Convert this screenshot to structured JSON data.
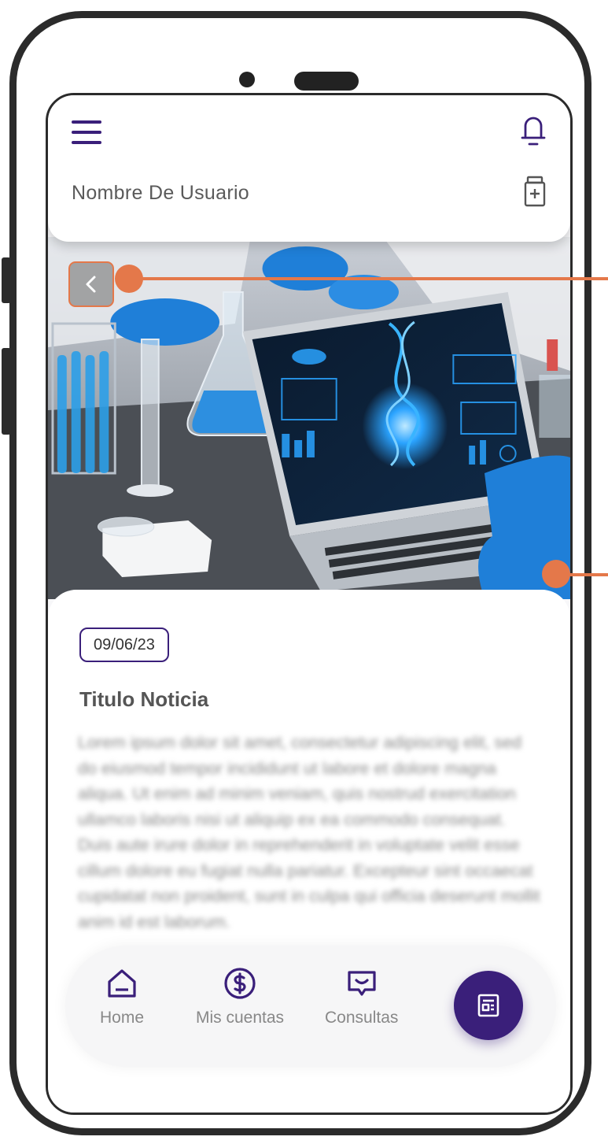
{
  "header": {
    "username": "Nombre De Usuario",
    "icons": {
      "menu": "hamburger-menu-icon",
      "notifications": "bell-icon",
      "medical": "medicine-bottle-icon"
    }
  },
  "hero": {
    "image_subject": "lab-laptop-dna",
    "back_icon": "chevron-left-icon"
  },
  "article": {
    "date": "09/06/23",
    "title": "Titulo Noticia",
    "body": "Lorem ipsum dolor sit amet, consectetur adipiscing elit, sed do eiusmod tempor incididunt ut labore et dolore magna aliqua. Ut enim ad minim veniam, quis nostrud exercitation ullamco laboris nisi ut aliquip ex ea commodo consequat. Duis aute irure dolor in reprehenderit in voluptate velit esse cillum dolore eu fugiat nulla pariatur. Excepteur sint occaecat cupidatat non proident, sunt in culpa qui officia deserunt mollit anim id est laborum."
  },
  "bottom_nav": {
    "items": [
      {
        "label": "Home",
        "icon": "home-icon"
      },
      {
        "label": "Mis cuentas",
        "icon": "dollar-circle-icon"
      },
      {
        "label": "Consultas",
        "icon": "chat-message-icon"
      }
    ],
    "fab_icon": "news-article-icon"
  },
  "colors": {
    "brand_purple": "#3a1f7a",
    "callout_orange": "#e4784a",
    "phone_frame": "#2b2b2b"
  }
}
